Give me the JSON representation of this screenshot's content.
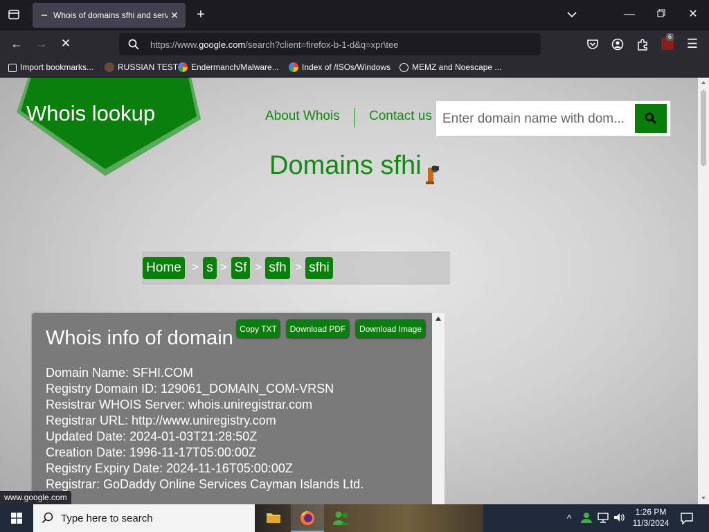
{
  "browser": {
    "tab_title": "Whois of domains sfhi and serv",
    "url_prefix": "https://www.",
    "url_domain": "google.com",
    "url_rest": "/search?client=firefox-b-1-d&q=xpr\\tee",
    "extension_badge": "6",
    "status_url": "www.google.com"
  },
  "bookmarks": [
    {
      "label": "Import bookmarks...",
      "icon": "import-icon"
    },
    {
      "label": "RUSSIAN TEST",
      "icon": "site-icon"
    },
    {
      "label": "Endermanch/Malware...",
      "icon": "google-icon"
    },
    {
      "label": "Index of /ISOs/Windows",
      "icon": "google-icon"
    },
    {
      "label": "MEMZ and Noescape ...",
      "icon": "globe-icon"
    }
  ],
  "site": {
    "logo": "Whois lookup",
    "nav_about": "About Whois",
    "nav_contact": "Contact us",
    "search_placeholder": "Enter domain name with dom...",
    "page_title": "Domains sfhi",
    "breadcrumb": [
      "Home",
      "s",
      "Sf",
      "sfh",
      "sfhi"
    ],
    "breadcrumb_sep": ">"
  },
  "whois": {
    "title": "Whois info of domain",
    "buttons": {
      "copy": "Copy TXT",
      "pdf": "Download PDF",
      "image": "Download Image"
    },
    "lines": [
      "Domain Name: SFHI.COM",
      "Registry Domain ID: 129061_DOMAIN_COM-VRSN",
      "Resistrar WHOIS Server: whois.uniregistrar.com",
      "Registrar URL: http://www.uniregistry.com",
      "Updated Date: 2024-01-03T21:28:50Z",
      "Creation Date: 1996-11-17T05:00:00Z",
      "Registry Expiry Date: 2024-11-16T05:00:00Z",
      "Registrar: GoDaddy Online Services Cayman Islands Ltd."
    ]
  },
  "taskbar": {
    "search_placeholder": "Type here to search",
    "time": "1:26 PM",
    "date": "11/3/2024"
  },
  "colors": {
    "brand_green": "#138a13",
    "button_green": "#0b7f0b"
  }
}
